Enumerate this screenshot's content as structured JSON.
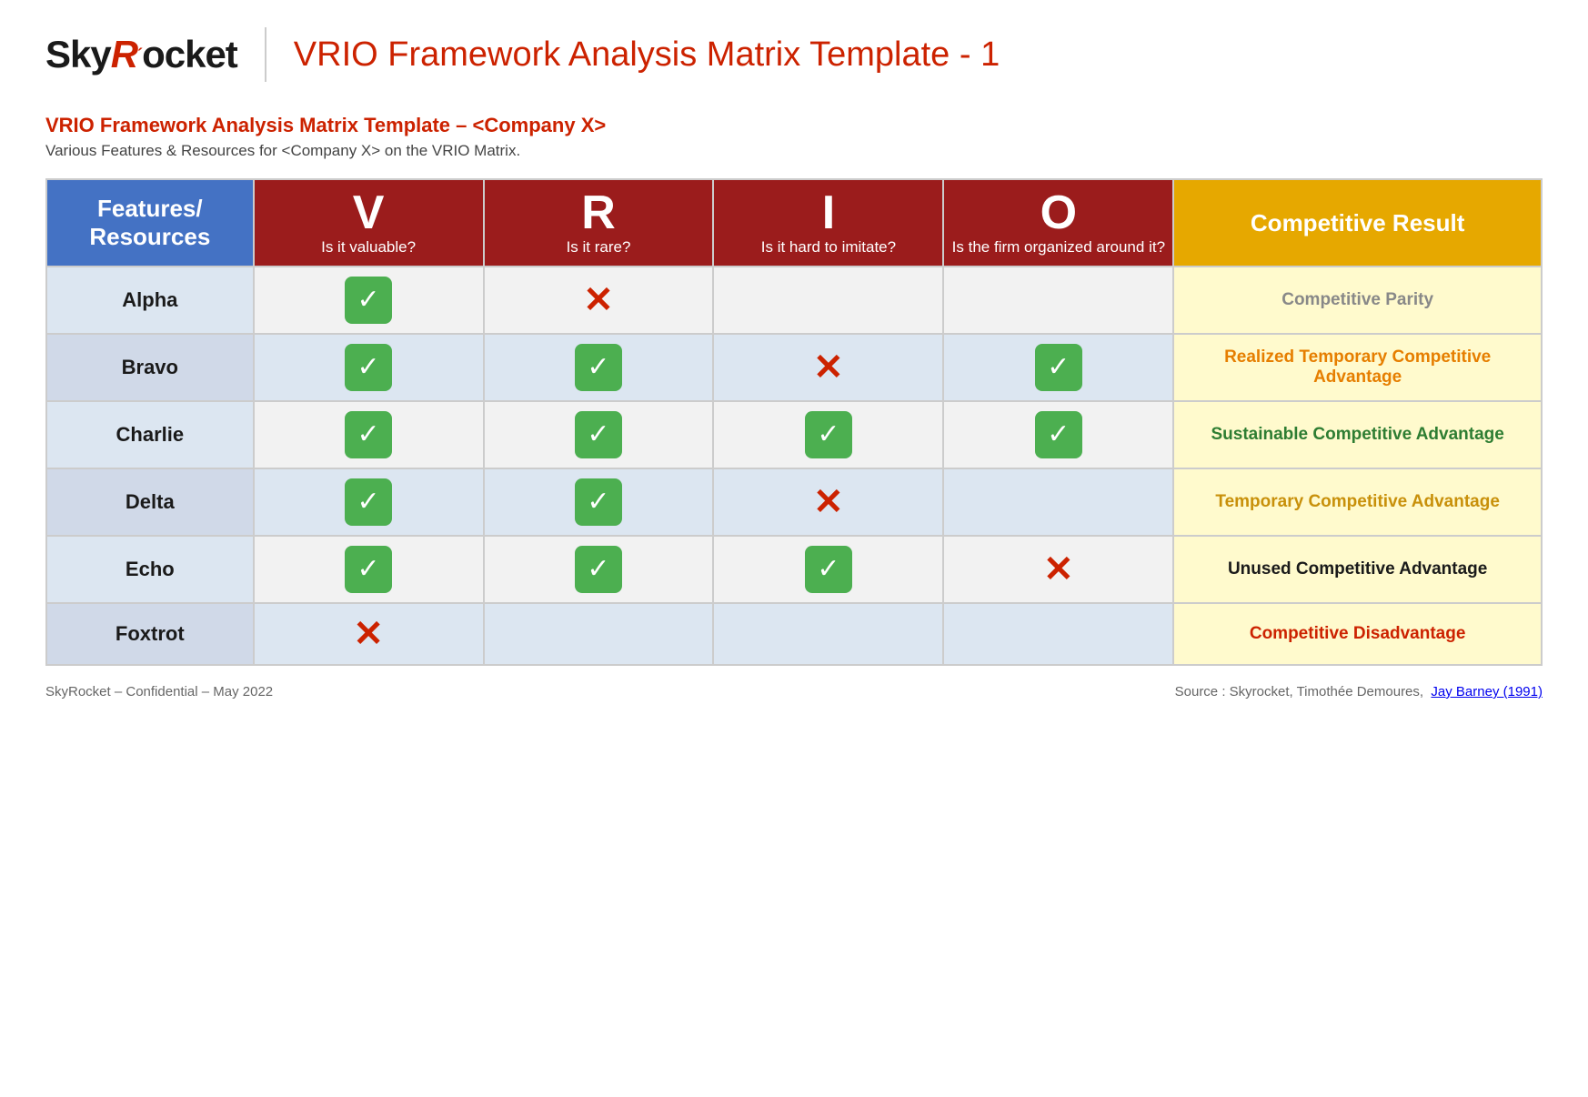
{
  "header": {
    "logo_sky": "Sky",
    "logo_r": "R",
    "logo_rocket": "ocket",
    "logo_accent": "´",
    "page_title": "VRIO Framework Analysis Matrix Template - 1",
    "subtitle_title": "VRIO Framework Analysis Matrix Template – <Company X>",
    "subtitle_desc": "Various Features & Resources for <Company X> on the VRIO Matrix."
  },
  "table": {
    "col_features": "Features/ Resources",
    "col_v_letter": "V",
    "col_v_sub": "Is it valuable?",
    "col_r_letter": "R",
    "col_r_sub": "Is it rare?",
    "col_i_letter": "I",
    "col_i_sub": "Is it hard to imitate?",
    "col_o_letter": "O",
    "col_o_sub": "Is the firm organized around it?",
    "col_result": "Competitive Result",
    "rows": [
      {
        "name": "Alpha",
        "v": "check",
        "r": "cross",
        "i": "",
        "o": "",
        "result": "Competitive Parity",
        "result_class": "result-gray"
      },
      {
        "name": "Bravo",
        "v": "check",
        "r": "check",
        "i": "cross",
        "o": "check",
        "result": "Realized Temporary Competitive Advantage",
        "result_class": "result-orange"
      },
      {
        "name": "Charlie",
        "v": "check",
        "r": "check",
        "i": "check",
        "o": "check",
        "result": "Sustainable Competitive Advantage",
        "result_class": "result-green"
      },
      {
        "name": "Delta",
        "v": "check",
        "r": "check",
        "i": "cross",
        "o": "",
        "result": "Temporary Competitive Advantage",
        "result_class": "result-tan"
      },
      {
        "name": "Echo",
        "v": "check",
        "r": "check",
        "i": "check",
        "o": "cross",
        "result": "Unused Competitive Advantage",
        "result_class": "result-dark"
      },
      {
        "name": "Foxtrot",
        "v": "cross",
        "r": "",
        "i": "",
        "o": "",
        "result": "Competitive Disadvantage",
        "result_class": "result-red"
      }
    ]
  },
  "footer": {
    "left": "SkyRocket – Confidential – May 2022",
    "right_prefix": "Source : Skyrocket, Timothée Demoures,",
    "right_link": "Jay Barney (1991)"
  }
}
